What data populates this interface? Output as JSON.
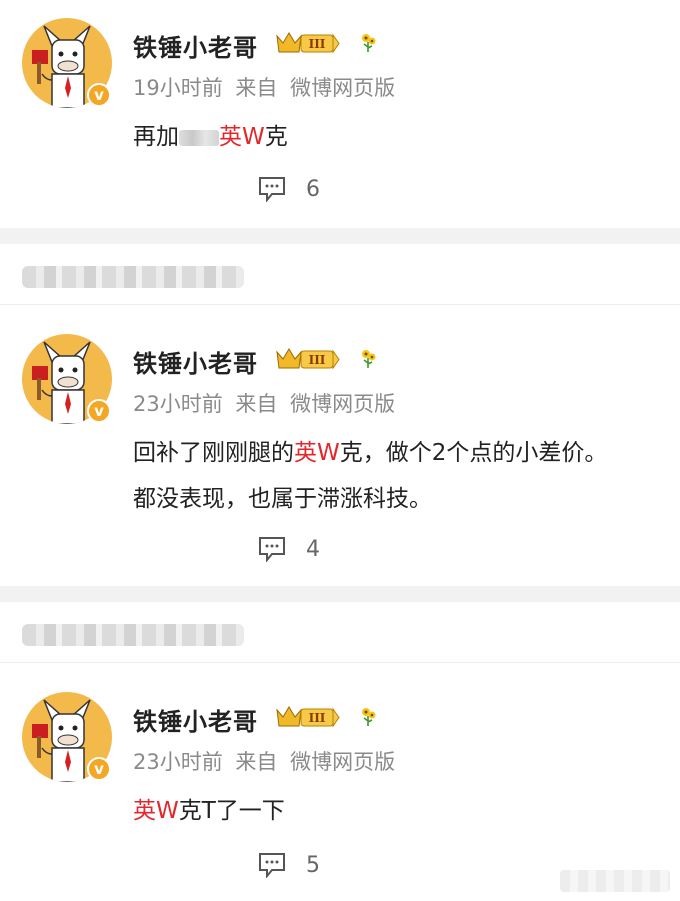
{
  "posts": [
    {
      "author": "铁锤小老哥",
      "time": "19小时前",
      "source_prefix": "来自",
      "source": "微博网页版",
      "content": [
        {
          "t": "再加"
        },
        {
          "t": "英",
          "kw": true
        },
        {
          "t": "W",
          "kw": true
        },
        {
          "t": "克"
        }
      ],
      "comment_count": "6"
    },
    {
      "author": "铁锤小老哥",
      "time": "23小时前",
      "source_prefix": "来自",
      "source": "微博网页版",
      "content_line1": [
        {
          "t": "回补了刚刚腿的"
        },
        {
          "t": "英",
          "kw": true
        },
        {
          "t": "W",
          "kw": true
        },
        {
          "t": "克，做个2个点的小差价。"
        }
      ],
      "content_line2": "都没表现，也属于滞涨科技。",
      "comment_count": "4"
    },
    {
      "author": "铁锤小老哥",
      "time": "23小时前",
      "source_prefix": "来自",
      "source": "微博网页版",
      "content": [
        {
          "t": "英",
          "kw": true
        },
        {
          "t": "W",
          "kw": true
        },
        {
          "t": "克T了一下"
        }
      ],
      "comment_count": "5"
    }
  ],
  "rank_badge": "III",
  "colors": {
    "keyword": "#e5262b",
    "meta": "#8a8a8a",
    "badge": "#f5a623",
    "separator": "#f2f2f2"
  },
  "icons": [
    "comment-icon",
    "verified-icon",
    "rank-crown-icon",
    "flower-icon"
  ]
}
